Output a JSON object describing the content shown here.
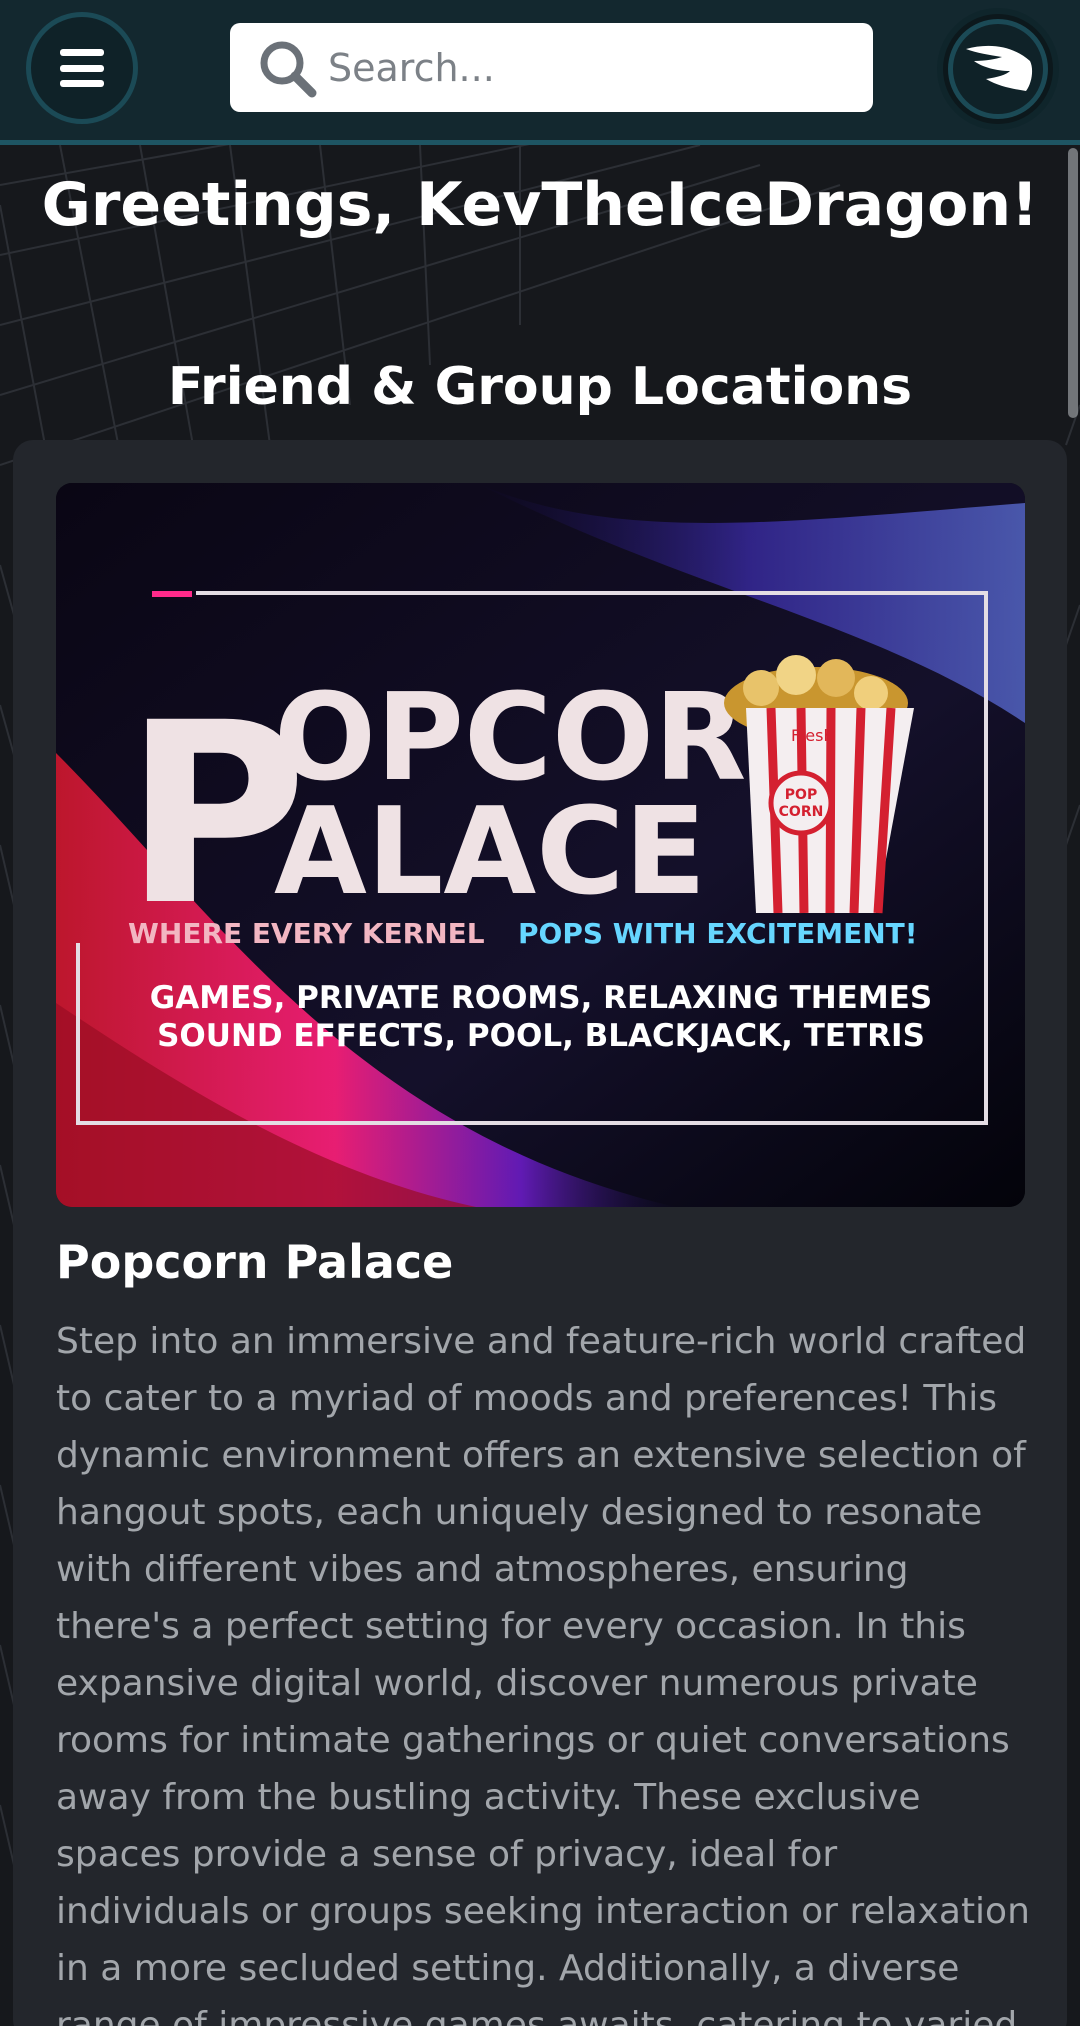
{
  "header": {
    "menu_icon": "hamburger-icon",
    "search": {
      "placeholder": "Search...",
      "value": ""
    },
    "avatar_icon": "wing-icon"
  },
  "greeting": "Greetings, KevTheIceDragon!",
  "section_title": "Friend & Group Locations",
  "card": {
    "banner": {
      "title_line1": "POPCORN",
      "title_line2": "PALACE",
      "tagline_part1": "WHERE EVERY KERNEL",
      "tagline_part2": "POPS WITH EXCITEMENT!",
      "features_line1": "GAMES, PRIVATE ROOMS, RELAXING THEMES",
      "features_line2": "SOUND EFFECTS, POOL, BLACKJACK, TETRIS",
      "bucket_label": "POP CORN",
      "bucket_tag": "Fresh"
    },
    "title": "Popcorn Palace",
    "description": "Step into an immersive and feature-rich world crafted to cater to a myriad of moods and preferences! This dynamic environment offers an extensive selection of hangout spots, each uniquely designed to resonate with different vibes and atmospheres, ensuring there's a perfect setting for every occasion. In this expansive digital world, discover numerous private rooms for intimate gatherings or quiet conversations away from the bustling activity. These exclusive spaces provide a sense of privacy, ideal for individuals or groups seeking interaction or relaxation in a more secluded setting. Additionally, a diverse range of impressive games awaits, catering to varied interests"
  },
  "colors": {
    "header_bg": "#13282f",
    "accent": "#1e5563",
    "page_bg": "#16181c",
    "card_bg": "#23262c",
    "desc_text": "#a2a6ab"
  }
}
